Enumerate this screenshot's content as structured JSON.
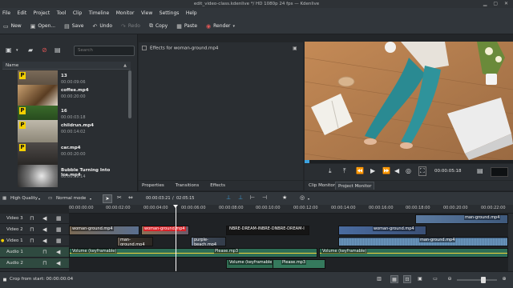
{
  "window": {
    "title": "edit_video-class.kdenlive */ HD 1080p 24 fps — Kdenlive",
    "controls": [
      "▁",
      "▢",
      "✕"
    ]
  },
  "menu": [
    "File",
    "Edit",
    "Project",
    "Tool",
    "Clip",
    "Timeline",
    "Monitor",
    "View",
    "Settings",
    "Help"
  ],
  "toolbar": [
    {
      "icon": "new-icon",
      "glyph": "▭",
      "label": "New",
      "enabled": true
    },
    {
      "icon": "open-icon",
      "glyph": "▣",
      "label": "Open...",
      "enabled": true
    },
    {
      "icon": "save-icon",
      "glyph": "▤",
      "label": "Save",
      "enabled": true
    },
    {
      "icon": "undo-icon",
      "glyph": "↶",
      "label": "Undo",
      "enabled": true
    },
    {
      "icon": "redo-icon",
      "glyph": "↷",
      "label": "Redo",
      "enabled": false
    },
    {
      "icon": "copy-icon",
      "glyph": "⧉",
      "label": "Copy",
      "enabled": true
    },
    {
      "icon": "paste-icon",
      "glyph": "▦",
      "label": "Paste",
      "enabled": true
    },
    {
      "icon": "render-icon",
      "glyph": "◉",
      "label": "Render",
      "enabled": true
    }
  ],
  "bin": {
    "search_placeholder": "Search",
    "column_header": "Name",
    "clips": [
      {
        "name": "13",
        "duration": "00:00:09:06"
      },
      {
        "name": "coffee.mp4",
        "duration": "00:00:20:00"
      },
      {
        "name": "16",
        "duration": "00:00:03:18"
      },
      {
        "name": "childrun.mp4",
        "duration": "00:00:14:02"
      },
      {
        "name": "car.mp4",
        "duration": "00:00:20:00"
      },
      {
        "name": "Bubble Turning Into Ice.mp4",
        "duration": "00:00:39:14"
      }
    ]
  },
  "effects": {
    "header": "Effects for woman-ground.mp4",
    "tabs": [
      "Properties",
      "Transitions",
      "Effects"
    ]
  },
  "monitor": {
    "timecode": "00:00:05:18",
    "tabs": [
      "Clip Monitor",
      "Project Monitor"
    ],
    "active_tab": "Project Monitor"
  },
  "timeline_toolbar": {
    "quality": "High Quality",
    "mode": "Normal mode",
    "position": "00:00:03:21",
    "duration": "02:05:15"
  },
  "ruler": [
    "00:00:00:00",
    "00:00:02:00",
    "00:00:04:00",
    "00:00:06:00",
    "00:00:08:00",
    "00:00:10:00",
    "00:00:12:00",
    "00:00:14:00",
    "00:00:16:00",
    "00:00:18:00",
    "00:00:20:00",
    "00:00:22:00"
  ],
  "tracks": [
    {
      "name": "Video 3",
      "type": "video"
    },
    {
      "name": "Video 2",
      "type": "video"
    },
    {
      "name": "Video 1",
      "type": "video"
    },
    {
      "name": "Audio 1",
      "type": "audio"
    },
    {
      "name": "Audio 2",
      "type": "audio"
    }
  ],
  "clips": {
    "v3_man": "man-ground.mp4",
    "v2_womanA": "woman-ground.mp4",
    "v2_womanB": "woman-ground.mp4",
    "v2_dream": "NBRE-DREAM-INBRE-DNBRE-DREAM-I",
    "v2_womanC": "woman-ground.mp4",
    "v1_man": "man-ground.mp4",
    "v1_purple": "purple-beach.mp4",
    "v1_man2": "man-ground.mp4",
    "a1_vol": "Volume (keyframable)",
    "a1_please": "Please.mp3",
    "a1_vol2": "Volume (keyframable)",
    "a2_vol": "Volume (keyframable)",
    "a2_please": "Please.mp3"
  },
  "status": {
    "text": "Crop from start: 00:00:00:04"
  }
}
